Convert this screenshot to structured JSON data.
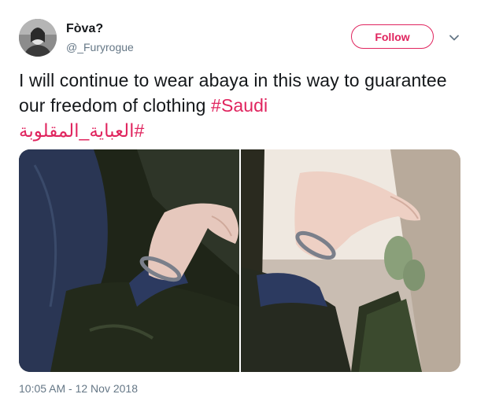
{
  "user": {
    "display_name": "Fòva?",
    "handle": "@_Furyrogue"
  },
  "follow_button": {
    "label": "Follow"
  },
  "tweet": {
    "text": "I will continue to wear abaya in this way to guarantee our freedom of clothing ",
    "hashtag_en": "#Saudi",
    "hashtag_ar": "#العباية_المقلوبة",
    "timestamp": "10:05 AM - 12 Nov 2018"
  },
  "icons": {
    "more": "chevron-down-icon"
  },
  "colors": {
    "accent": "#e0245e",
    "text": "#14171a",
    "secondary_text": "#657786"
  }
}
